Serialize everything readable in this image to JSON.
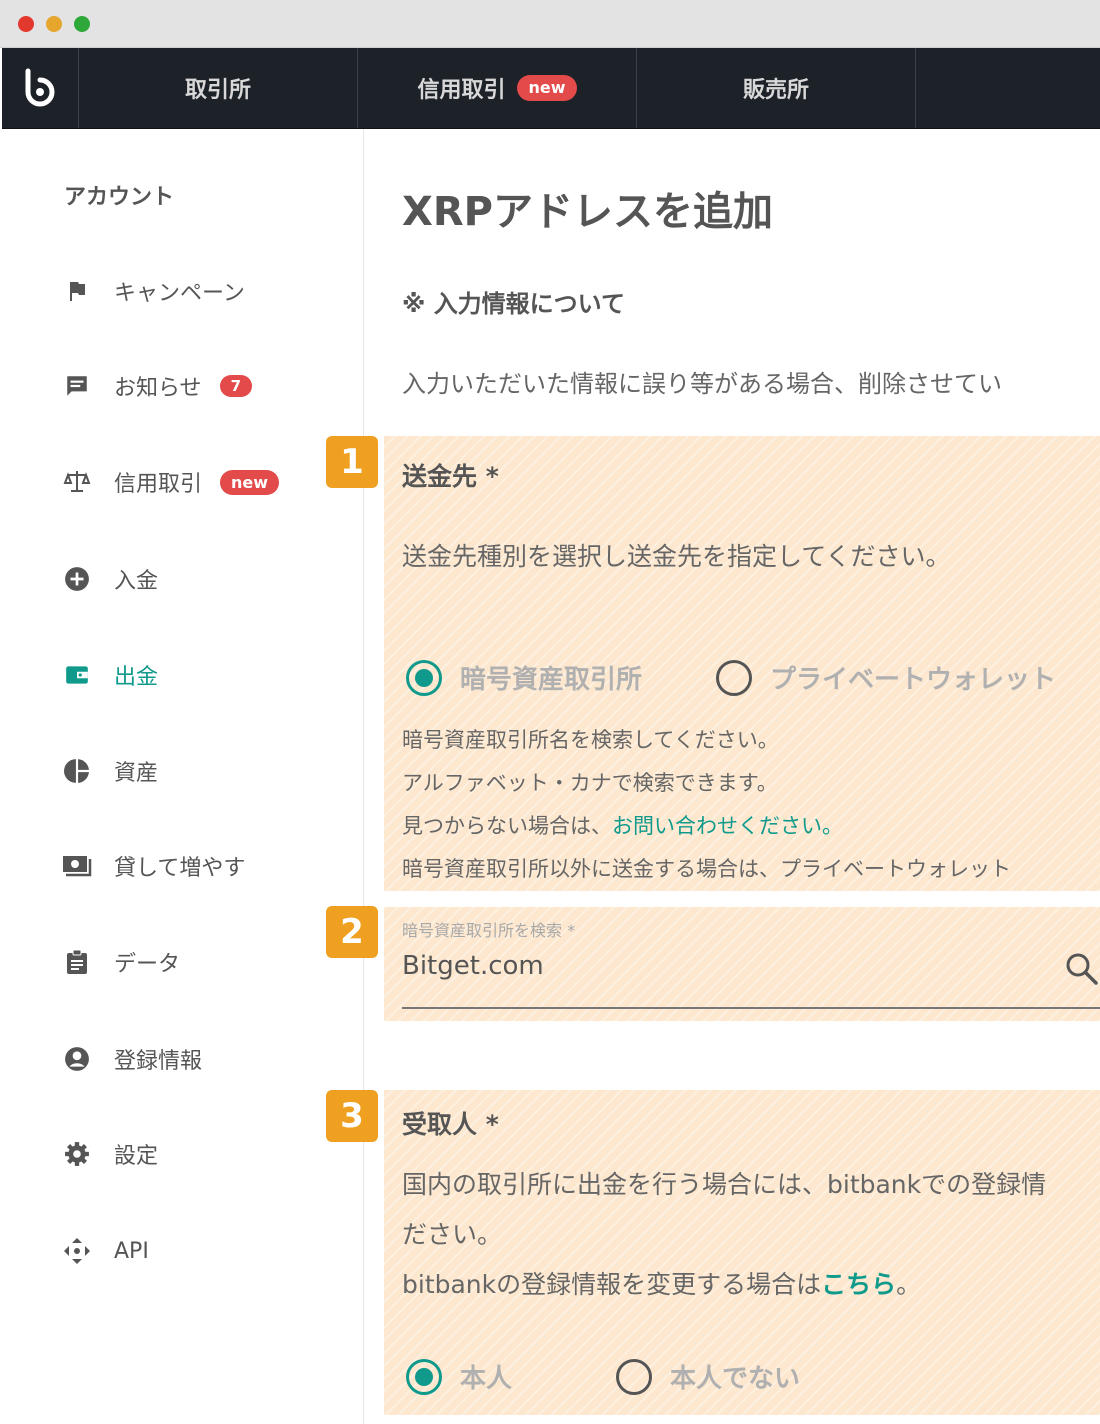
{
  "topnav": {
    "tabs": [
      {
        "label": "取引所"
      },
      {
        "label": "信用取引",
        "badge": "new"
      },
      {
        "label": "販売所"
      }
    ]
  },
  "sidebar": {
    "heading": "アカウント",
    "items": [
      {
        "label": "キャンペーン",
        "icon": "flag-icon"
      },
      {
        "label": "お知らせ",
        "icon": "message-icon",
        "badge": "7"
      },
      {
        "label": "信用取引",
        "icon": "scale-icon",
        "badge": "new"
      },
      {
        "label": "入金",
        "icon": "plus-circle-icon"
      },
      {
        "label": "出金",
        "icon": "wallet-icon",
        "active": true
      },
      {
        "label": "資産",
        "icon": "pie-chart-icon"
      },
      {
        "label": "貸して増やす",
        "icon": "cash-icon"
      },
      {
        "label": "データ",
        "icon": "clipboard-icon"
      },
      {
        "label": "登録情報",
        "icon": "account-circle-icon"
      },
      {
        "label": "設定",
        "icon": "gear-icon"
      },
      {
        "label": "API",
        "icon": "api-icon"
      }
    ]
  },
  "main": {
    "title": "XRPアドレスを追加",
    "note_heading": "※ 入力情報について",
    "note_text": "入力いただいた情報に誤り等がある場合、削除させてい",
    "steps": [
      "1",
      "2",
      "3"
    ],
    "destination": {
      "title": "送金先 *",
      "description": "送金先種別を選択し送金先を指定してください。",
      "options": [
        "暗号資産取引所",
        "プライベートウォレット"
      ],
      "help_lines": [
        "暗号資産取引所名を検索してください。",
        "アルファベット・カナで検索できます。",
        "見つからない場合は、",
        "暗号資産取引所以外に送金する場合は、プライベートウォレット"
      ],
      "contact_link": "お問い合わせください。"
    },
    "exchange_search": {
      "label": "暗号資産取引所を検索 *",
      "value": "Bitget.com"
    },
    "recipient": {
      "title": "受取人 *",
      "line1": "国内の取引所に出金を行う場合には、bitbankでの登録情",
      "line2": "ださい。",
      "line3": "bitbankの登録情報を変更する場合は",
      "link": "こちら",
      "line3_end": "。",
      "options": [
        "本人",
        "本人でない"
      ]
    }
  },
  "colors": {
    "accent": "#0f9a8c",
    "badge": "#e34a4a",
    "highlight": "#fde8cf",
    "step": "#f0a020",
    "nav_bg": "#1d2128"
  }
}
